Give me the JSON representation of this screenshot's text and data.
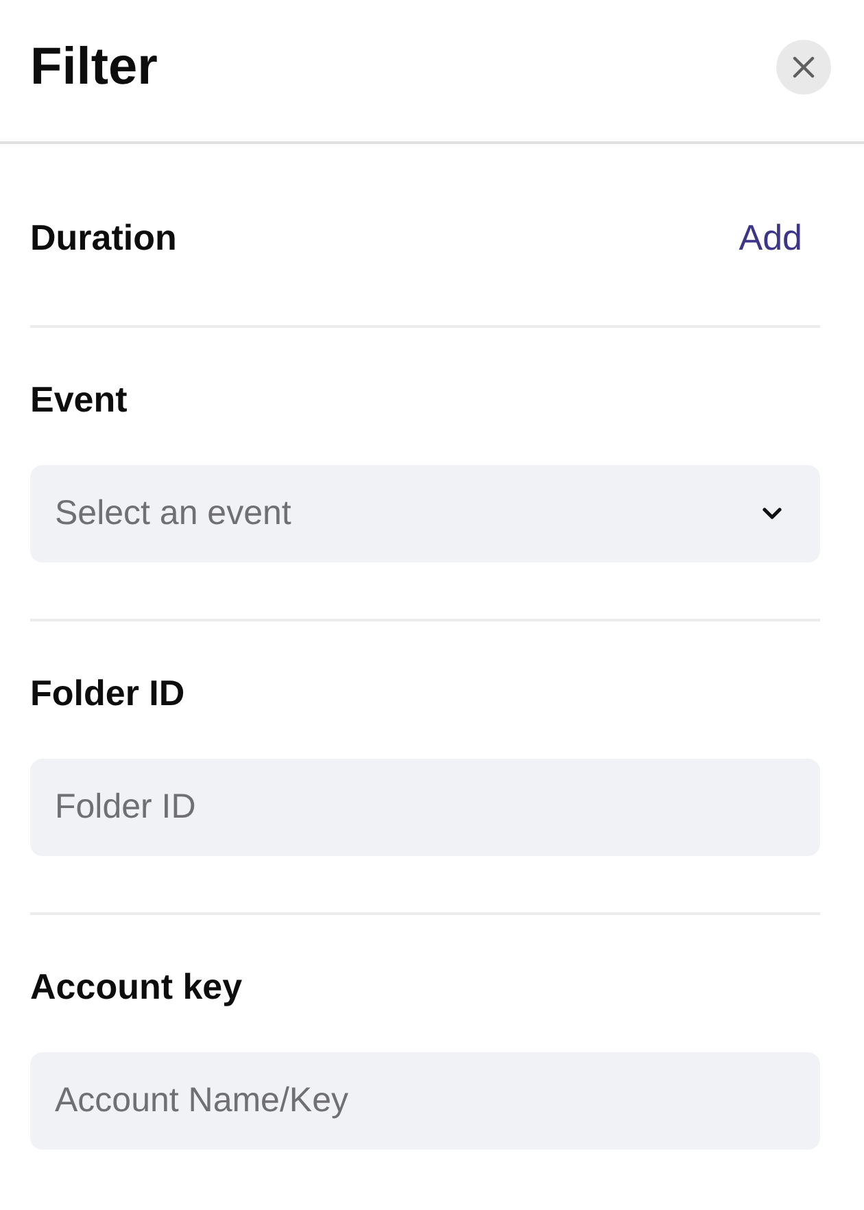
{
  "header": {
    "title": "Filter"
  },
  "sections": [
    {
      "kind": "action",
      "label": "Duration",
      "action": "Add"
    },
    {
      "kind": "select",
      "label": "Event",
      "placeholder": "Select an event"
    },
    {
      "kind": "input",
      "label": "Folder ID",
      "placeholder": "Folder ID"
    },
    {
      "kind": "input",
      "label": "Account key",
      "placeholder": "Account Name/Key"
    }
  ]
}
